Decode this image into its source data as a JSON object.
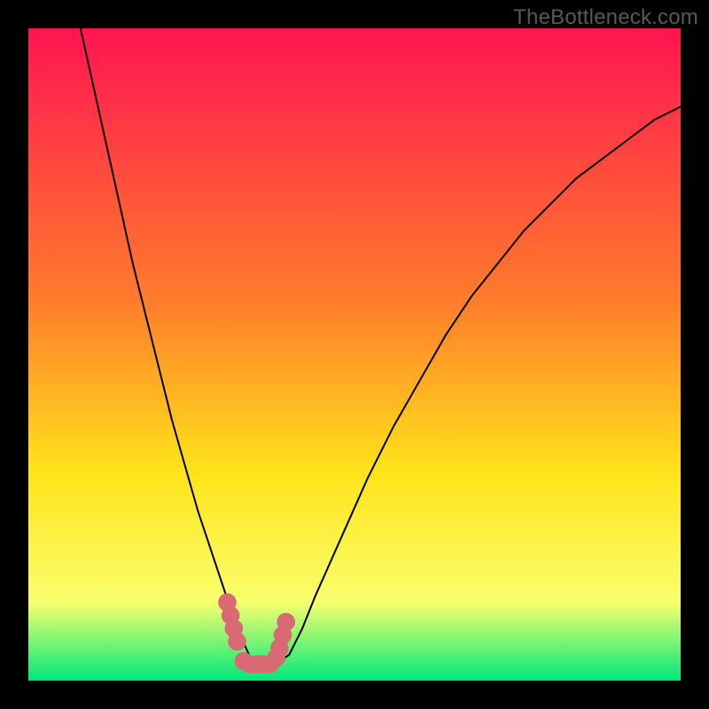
{
  "watermark": "TheBottleneck.com",
  "colors": {
    "gradient_top": "#ff1451",
    "gradient_mid1": "#ff7d2b",
    "gradient_mid2": "#ffe31a",
    "gradient_mid3": "#f8ff6e",
    "gradient_bottom": "#00e87a",
    "curve": "#000000",
    "marker": "#d96a73",
    "frame": "#000000"
  },
  "chart_data": {
    "type": "line",
    "title": "",
    "xlabel": "",
    "ylabel": "",
    "xlim": [
      0,
      100
    ],
    "ylim": [
      0,
      100
    ],
    "series": [
      {
        "name": "bottleneck-curve",
        "x": [
          8,
          10,
          12,
          14,
          16,
          18,
          20,
          22,
          24,
          26,
          28,
          30,
          32,
          34.5,
          36,
          38,
          40,
          42,
          44,
          48,
          52,
          56,
          60,
          64,
          68,
          72,
          76,
          80,
          84,
          88,
          92,
          96,
          100
        ],
        "y": [
          100,
          91,
          82,
          73,
          64,
          56,
          48,
          40,
          33,
          26,
          20,
          14,
          8,
          2.5,
          2,
          2.5,
          4,
          8,
          13,
          22,
          31,
          39,
          46,
          53,
          59,
          64,
          69,
          73,
          77,
          80,
          83,
          86,
          88
        ]
      }
    ],
    "markers": {
      "name": "highlight-band",
      "x": [
        30.5,
        31,
        31.5,
        32,
        33,
        34,
        35,
        36,
        37,
        38,
        38.5,
        39,
        39.5
      ],
      "y": [
        12,
        10,
        8,
        6,
        3,
        2.5,
        2.5,
        2.5,
        2.5,
        3.5,
        5,
        7,
        9
      ]
    }
  }
}
